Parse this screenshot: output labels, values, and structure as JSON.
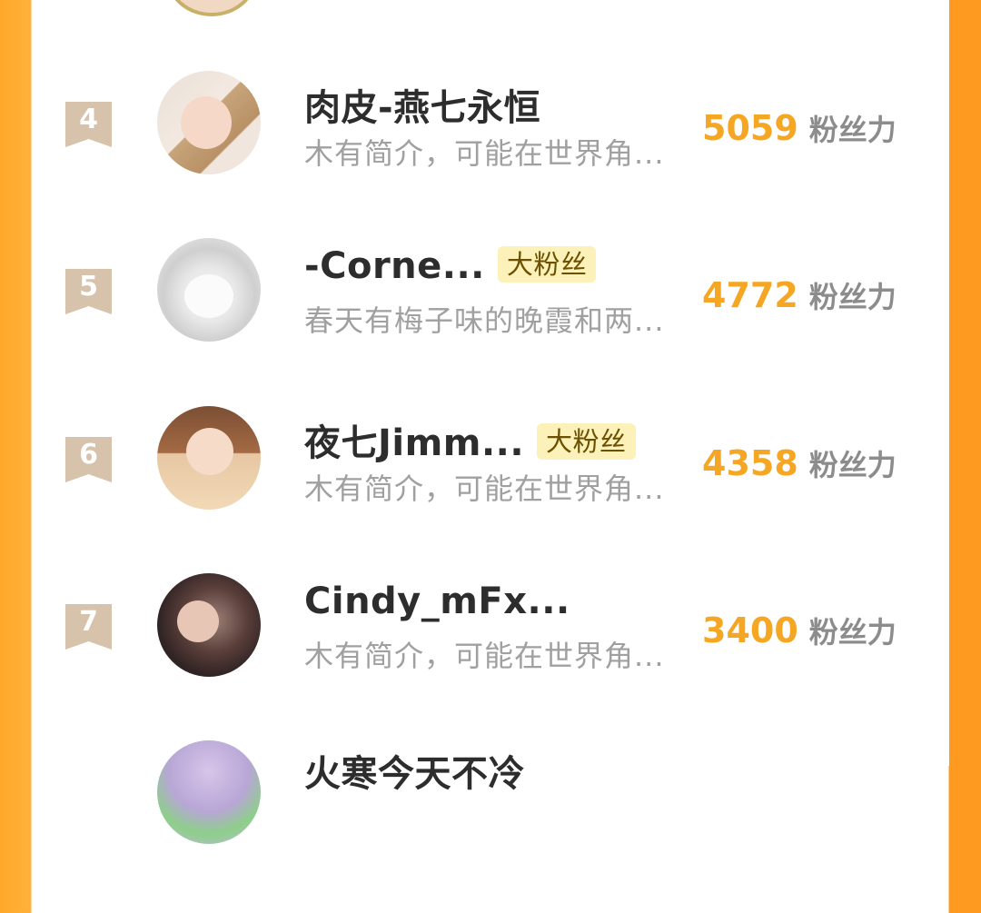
{
  "colors": {
    "accent": "#f5a623",
    "badge_bg": "#fbf1b9",
    "rank_bg": "#d7c2ab"
  },
  "score_unit": "粉丝力",
  "rows": [
    {
      "rank": "4",
      "name": "肉皮-燕七永恒",
      "badge": "",
      "bio": "木有简介，可能在世界角...",
      "score": "5059"
    },
    {
      "rank": "5",
      "name": "-Corne...",
      "badge": "大粉丝",
      "bio": "春天有梅子味的晚霞和两...",
      "score": "4772"
    },
    {
      "rank": "6",
      "name": "夜七Jimm...",
      "badge": "大粉丝",
      "bio": "木有简介，可能在世界角...",
      "score": "4358"
    },
    {
      "rank": "7",
      "name": "Cindy_mFx...",
      "badge": "",
      "bio": "木有简介，可能在世界角...",
      "score": "3400"
    }
  ],
  "partial_next_name": "火寒今天不冷"
}
